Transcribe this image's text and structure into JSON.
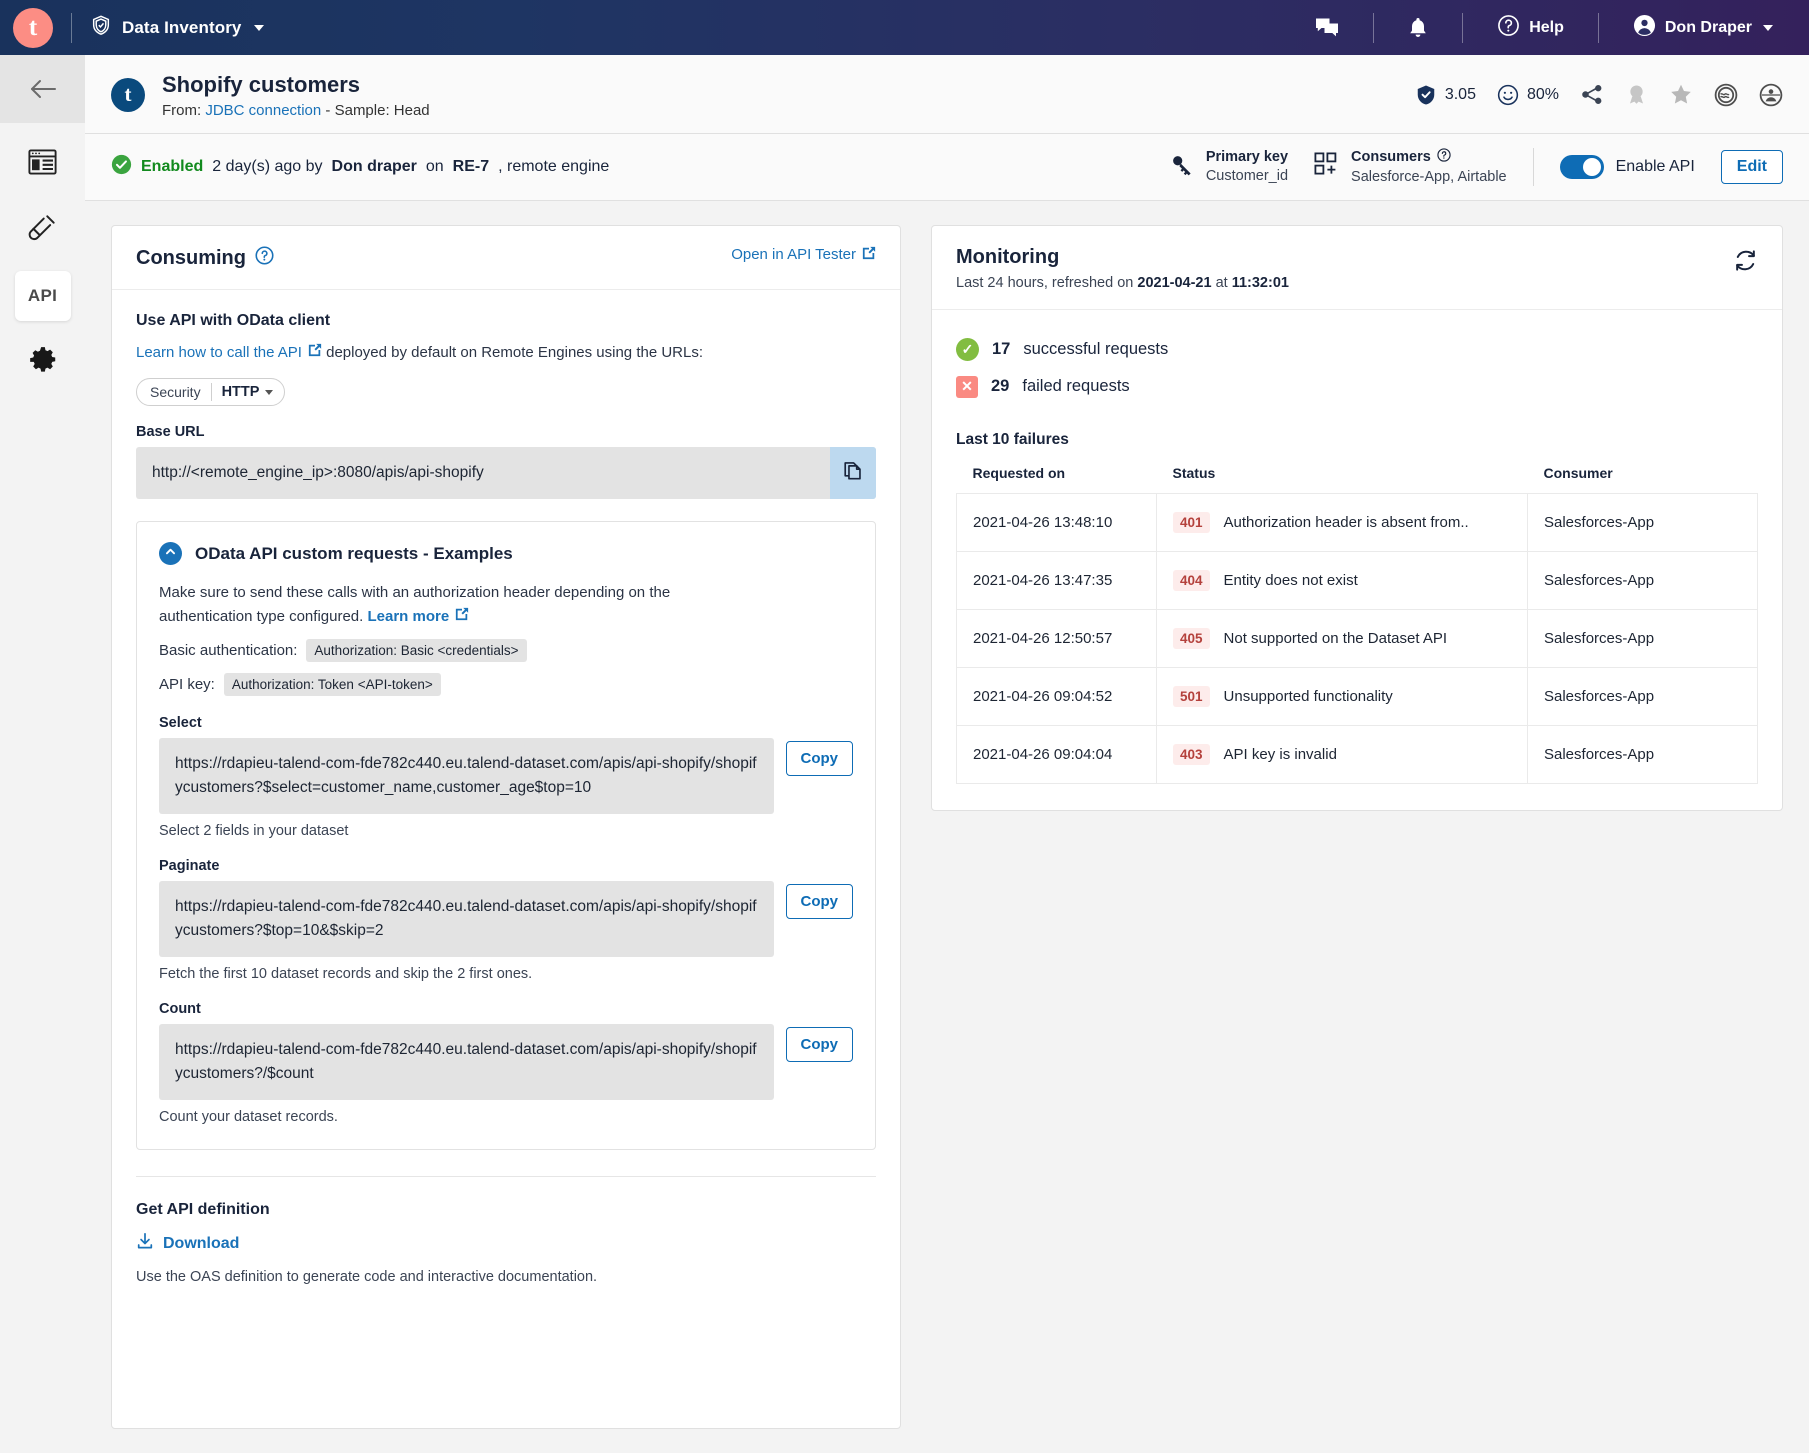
{
  "topbar": {
    "logo_letter": "t",
    "module": "Data Inventory",
    "items": [
      {
        "name": "messages-icon",
        "label": ""
      },
      {
        "name": "bell-icon",
        "label": ""
      },
      {
        "name": "help",
        "label": "Help"
      },
      {
        "name": "user",
        "label": "Don Draper"
      }
    ],
    "help_label": "Help",
    "user_label": "Don Draper"
  },
  "rail": {
    "back": "back-arrow",
    "items": [
      {
        "name": "overview-icon",
        "label": ""
      },
      {
        "name": "sample-icon",
        "label": ""
      },
      {
        "name": "api-tab",
        "label": "API"
      },
      {
        "name": "settings-icon",
        "label": ""
      }
    ],
    "api_label": "API"
  },
  "header": {
    "avatar_letter": "t",
    "title": "Shopify customers",
    "from_label": "From:",
    "connection": "JDBC connection",
    "separator": "-",
    "sample": "Sample: Head",
    "badges": {
      "trust_score": "3.05",
      "popularity": "80%"
    }
  },
  "status": {
    "state": "Enabled",
    "detail_pre": "2 day(s) ago by",
    "author": "Don draper",
    "detail_mid": "on",
    "engine": "RE-7",
    "detail_post": ", remote engine",
    "primary_key_label": "Primary key",
    "primary_key_value": "Customer_id",
    "consumers_label": "Consumers",
    "consumers_value": "Salesforce-App, Airtable",
    "enable_api_label": "Enable API",
    "edit_label": "Edit"
  },
  "consuming": {
    "title": "Consuming",
    "open_tester": "Open in API Tester",
    "section_title": "Use API with OData client",
    "learn_link": "Learn how to call the API",
    "learn_rest": "deployed by default on Remote Engines using the URLs:",
    "security_label": "Security",
    "security_value": "HTTP",
    "base_url_label": "Base URL",
    "base_url_value": "http://<remote_engine_ip>:8080/apis/api-shopify",
    "examples": {
      "title": "OData API custom requests - Examples",
      "note_1": "Make sure to send these calls with an authorization header depending on the",
      "note_2": "authentication type configured.",
      "learn_more": "Learn more",
      "basic_label": "Basic authentication:",
      "basic_value": "Authorization: Basic <credentials>",
      "apikey_label": "API key:",
      "apikey_value": "Authorization: Token <API-token>",
      "copy_label": "Copy",
      "items": [
        {
          "label": "Select",
          "url": "https://rdapieu-talend-com-fde782c440.eu.talend-dataset.com/apis/api-shopify/shopifycustomers?$select=customer_name,customer_age$top=10",
          "hint": "Select 2 fields in your dataset"
        },
        {
          "label": "Paginate",
          "url": "https://rdapieu-talend-com-fde782c440.eu.talend-dataset.com/apis/api-shopify/shopifycustomers?$top=10&$skip=2",
          "hint": "Fetch the first 10 dataset records and skip the 2 first ones."
        },
        {
          "label": "Count",
          "url": "https://rdapieu-talend-com-fde782c440.eu.talend-dataset.com/apis/api-shopify/shopifycustomers?/$count",
          "hint": "Count your dataset records."
        }
      ]
    },
    "get_definition_title": "Get API definition",
    "download_label": "Download",
    "definition_hint": "Use the OAS definition to generate code and interactive documentation."
  },
  "monitoring": {
    "title": "Monitoring",
    "subtitle_pre": "Last 24 hours, refreshed on",
    "refresh_date": "2021-04-21",
    "subtitle_mid": "at",
    "refresh_time": "11:32:01",
    "successful_count": "17",
    "successful_label": "successful requests",
    "failed_count": "29",
    "failed_label": "failed requests",
    "failures_title": "Last 10 failures",
    "columns": [
      "Requested on",
      "Status",
      "Consumer"
    ],
    "rows": [
      {
        "requested_on": "2021-04-26 13:48:10",
        "code": "401",
        "message": "Authorization header is absent from..",
        "consumer": "Salesforces-App"
      },
      {
        "requested_on": "2021-04-26 13:47:35",
        "code": "404",
        "message": "Entity does not exist",
        "consumer": "Salesforces-App"
      },
      {
        "requested_on": "2021-04-26 12:50:57",
        "code": "405",
        "message": "Not supported on the Dataset API",
        "consumer": "Salesforces-App"
      },
      {
        "requested_on": "2021-04-26 09:04:52",
        "code": "501",
        "message": "Unsupported functionality",
        "consumer": "Salesforces-App"
      },
      {
        "requested_on": "2021-04-26 09:04:04",
        "code": "403",
        "message": "API key is invalid",
        "consumer": "Salesforces-App"
      }
    ]
  },
  "colors": {
    "accent": "#1a72b8",
    "topbar_start": "#19325c",
    "topbar_end": "#34215c",
    "logo": "#fc8d84",
    "success": "#82bd41",
    "error": "#fa8a82",
    "enabled_text": "#128a1e"
  }
}
